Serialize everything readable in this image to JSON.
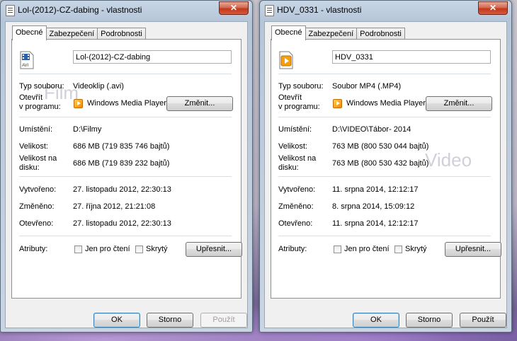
{
  "windows": [
    {
      "title": "Lol-(2012)-CZ-dabing - vlastnosti",
      "tabs": [
        "Obecné",
        "Zabezpečení",
        "Podrobnosti"
      ],
      "file_name": "Lol-(2012)-CZ-dabing",
      "icon_label": "AVI",
      "watermark": "Film",
      "labels": {
        "type": "Typ souboru:",
        "open_with": "Otevřít\nv programu:",
        "location": "Umístění:",
        "size": "Velikost:",
        "size_on_disk": "Velikost na\ndisku:",
        "created": "Vytvořeno:",
        "modified": "Změněno:",
        "accessed": "Otevřeno:",
        "attributes": "Atributy:"
      },
      "values": {
        "type": "Videoklip (.avi)",
        "open_with": "Windows Media Player",
        "location": "D:\\Filmy",
        "size": "686 MB (719 835 746 bajtů)",
        "size_on_disk": "686 MB (719 839 232 bajtů)",
        "created": "27. listopadu 2012, 22:30:13",
        "modified": "27. října 2012, 21:21:08",
        "accessed": "27. listopadu 2012, 22:30:13"
      },
      "change_button": "Změnit...",
      "readonly_label": "Jen pro čtení",
      "hidden_label": "Skrytý",
      "advanced_button": "Upřesnit...",
      "ok_button": "OK",
      "cancel_button": "Storno",
      "apply_button": "Použít"
    },
    {
      "title": "HDV_0331 - vlastnosti",
      "tabs": [
        "Obecné",
        "Zabezpečení",
        "Podrobnosti"
      ],
      "file_name": "HDV_0331",
      "icon_label": "",
      "watermark": "Video",
      "labels": {
        "type": "Typ souboru:",
        "open_with": "Otevřít\nv programu:",
        "location": "Umístění:",
        "size": "Velikost:",
        "size_on_disk": "Velikost na\ndisku:",
        "created": "Vytvořeno:",
        "modified": "Změněno:",
        "accessed": "Otevřeno:",
        "attributes": "Atributy:"
      },
      "values": {
        "type": "Soubor MP4 (.MP4)",
        "open_with": "Windows Media Player",
        "location": "D:\\VIDEO\\Tábor- 2014",
        "size": "763 MB (800 530 044 bajtů)",
        "size_on_disk": "763 MB (800 530 432 bajtů)",
        "created": "11. srpna 2014, 12:12:17",
        "modified": "8. srpna 2014, 15:09:12",
        "accessed": "11. srpna 2014, 12:12:17"
      },
      "change_button": "Změnit...",
      "readonly_label": "Jen pro čtení",
      "hidden_label": "Skrytý",
      "advanced_button": "Upřesnit...",
      "ok_button": "OK",
      "cancel_button": "Storno",
      "apply_button": "Použít"
    }
  ],
  "colors": {
    "accent_close": "#c2381c",
    "media_icon": "#f08a00"
  }
}
